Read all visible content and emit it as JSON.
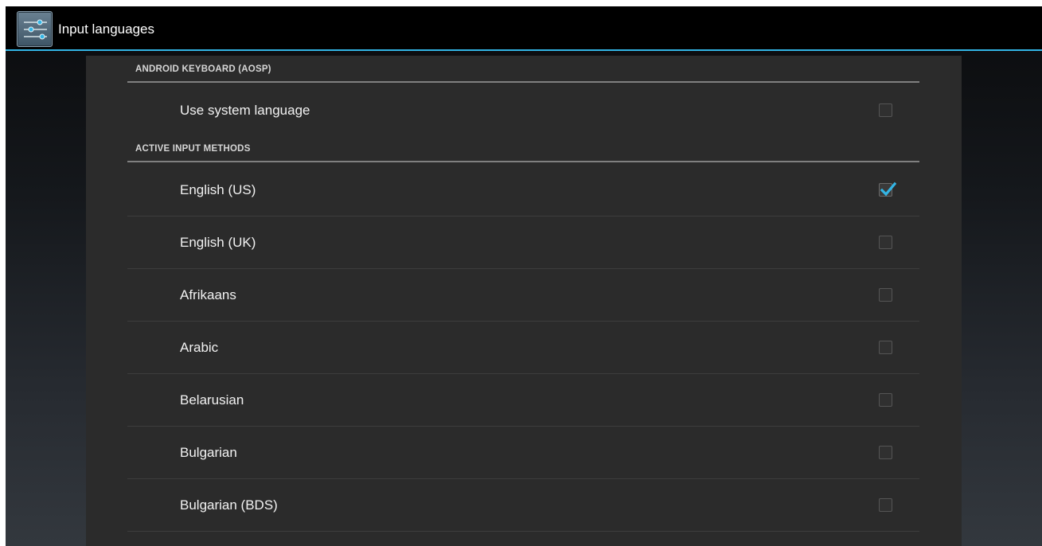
{
  "actionbar": {
    "title": "Input languages",
    "icon": "settings-sliders-icon",
    "accent_color": "#33b5e5"
  },
  "sections": [
    {
      "header": "ANDROID KEYBOARD (AOSP)",
      "items": [
        {
          "label": "Use system language",
          "checked": false
        }
      ]
    },
    {
      "header": "ACTIVE INPUT METHODS",
      "items": [
        {
          "label": "English (US)",
          "checked": true
        },
        {
          "label": "English (UK)",
          "checked": false
        },
        {
          "label": "Afrikaans",
          "checked": false
        },
        {
          "label": "Arabic",
          "checked": false
        },
        {
          "label": "Belarusian",
          "checked": false
        },
        {
          "label": "Bulgarian",
          "checked": false
        },
        {
          "label": "Bulgarian (BDS)",
          "checked": false
        }
      ]
    }
  ],
  "colors": {
    "check_mark": "#33b5e5",
    "panel_background": "#2b2b2b",
    "header_divider": "#808080"
  }
}
